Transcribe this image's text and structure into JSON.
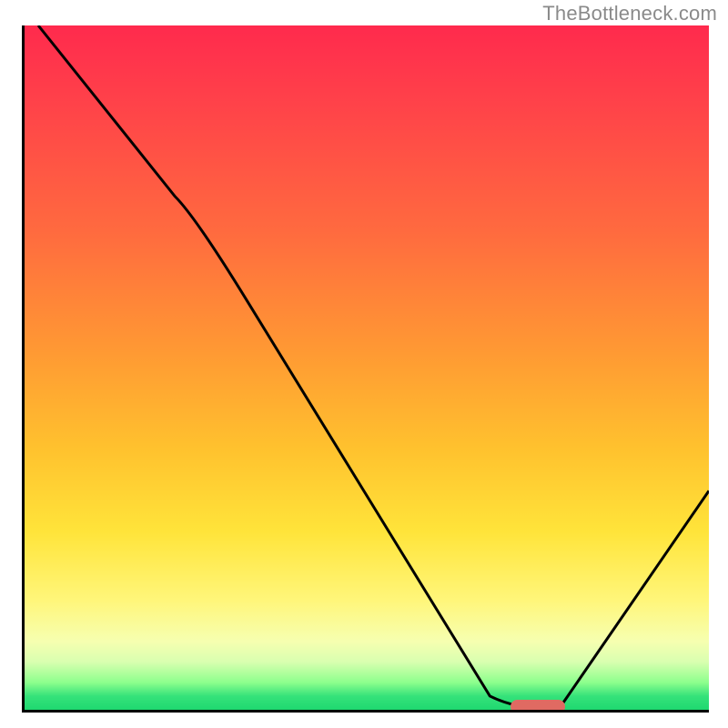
{
  "watermark": "TheBottleneck.com",
  "chart_data": {
    "type": "line",
    "title": "",
    "xlabel": "",
    "ylabel": "",
    "xlim": [
      0,
      100
    ],
    "ylim": [
      0,
      100
    ],
    "grid": false,
    "legend": false,
    "series": [
      {
        "name": "curve",
        "x": [
          2,
          22,
          25,
          68,
          72,
          78,
          100
        ],
        "values": [
          100,
          75,
          72,
          2,
          0,
          0,
          32
        ]
      }
    ],
    "marker": {
      "x_start": 71,
      "x_end": 79,
      "y": 0.5
    },
    "background_gradient": {
      "stops": [
        {
          "pos": 0.0,
          "color": "#ff2a4d"
        },
        {
          "pos": 0.1,
          "color": "#ff3f4a"
        },
        {
          "pos": 0.3,
          "color": "#ff6a3f"
        },
        {
          "pos": 0.48,
          "color": "#ff9a33"
        },
        {
          "pos": 0.62,
          "color": "#ffc22e"
        },
        {
          "pos": 0.74,
          "color": "#ffe43a"
        },
        {
          "pos": 0.84,
          "color": "#fff67a"
        },
        {
          "pos": 0.9,
          "color": "#f6ffb0"
        },
        {
          "pos": 0.93,
          "color": "#d9ffb0"
        },
        {
          "pos": 0.96,
          "color": "#8dff8d"
        },
        {
          "pos": 0.98,
          "color": "#35e27a"
        },
        {
          "pos": 1.0,
          "color": "#1fd870"
        }
      ]
    }
  }
}
